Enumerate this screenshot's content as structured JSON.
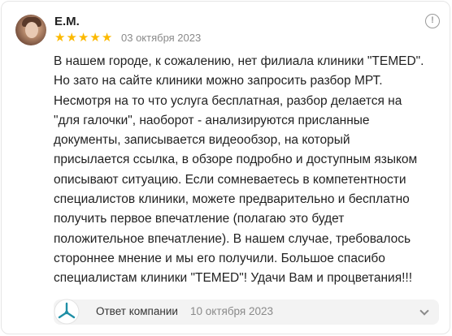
{
  "review": {
    "author": "Е.М.",
    "rating": 5,
    "stars": [
      "★",
      "★",
      "★",
      "★",
      "★"
    ],
    "date": "03 октября 2023",
    "text_lines": [
      "В нашем городе, к сожалению, нет филиала клиники \"TEMED\".",
      "Но зато на сайте клиники можно запросить разбор МРТ.",
      "Несмотря на то что услуга бесплатная, разбор делается на",
      "\"для галочки\", наоборот - анализируются присланные",
      "документы, записывается видеообзор, на который",
      "присылается ссылка, в обзоре подробно и доступным языком",
      "описывают ситуацию. Если сомневаетесь в компетентности",
      "специалистов клиники, можете предварительно и бесплатно",
      "получить первое впечатление (полагаю это будет",
      "положительное впечатление). В нашем случае, требовалось",
      "стороннее мнение и мы его получили. Большое спасибо",
      "специалистам клиники \"TEMED\"! Удачи Вам и процветания!!!"
    ],
    "info_icon": "!"
  },
  "company_reply": {
    "label": "Ответ компании",
    "date": "10 октября 2023",
    "logo_icon": "company-logo-icon",
    "chevron_icon": "chevron-down-icon"
  },
  "colors": {
    "star": "#fcb900",
    "muted": "#8a8a8a",
    "logo": "#1f8fa6"
  }
}
